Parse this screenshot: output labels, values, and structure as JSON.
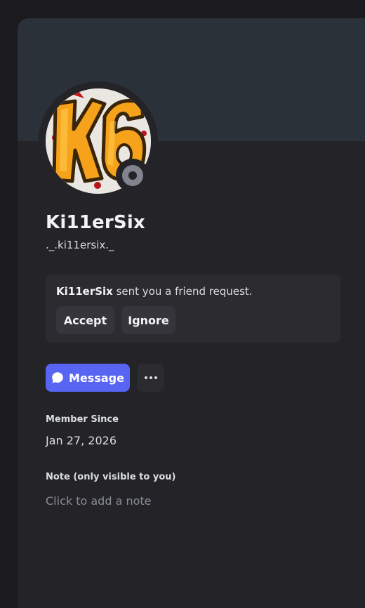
{
  "profile": {
    "display_name": "Ki11erSix",
    "username": "._.ki11ersix._",
    "avatar_text": "K6",
    "status": "offline"
  },
  "friend_request": {
    "sender": "Ki11erSix",
    "message": " sent you a friend request.",
    "accept_label": "Accept",
    "ignore_label": "Ignore"
  },
  "actions": {
    "message_label": "Message",
    "more_icon": "more-horizontal-icon",
    "message_icon": "chat-bubble-icon"
  },
  "member_since": {
    "label": "Member Since",
    "value": "Jan 27, 2026"
  },
  "note": {
    "label": "Note (only visible to you)",
    "placeholder": "Click to add a note",
    "value": ""
  },
  "colors": {
    "brand": "#5865f2",
    "panel": "#232328",
    "banner": "#2b3139",
    "status_offline": "#80848e"
  }
}
